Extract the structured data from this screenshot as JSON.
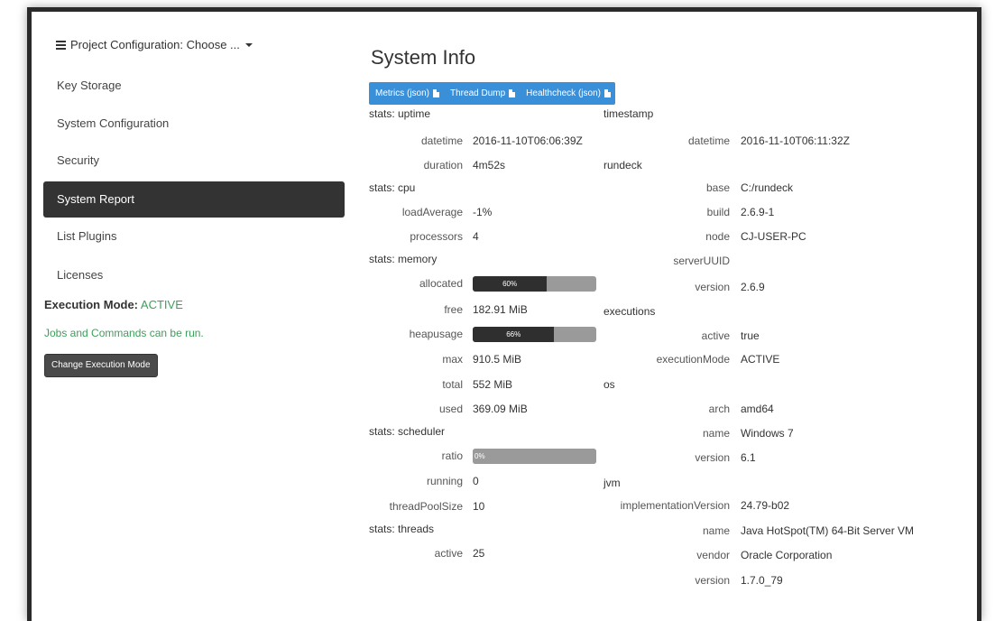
{
  "sidebar": {
    "project_menu": "Project Configuration: Choose ...",
    "items": [
      {
        "label": "Key Storage"
      },
      {
        "label": "System Configuration"
      },
      {
        "label": "Security"
      },
      {
        "label": "System Report",
        "active": true
      },
      {
        "label": "List Plugins"
      },
      {
        "label": "Licenses"
      }
    ],
    "execution_mode_label": "Execution Mode:",
    "execution_mode_value": "ACTIVE",
    "execution_note": "Jobs and Commands can be run.",
    "change_mode_button": "Change Execution Mode"
  },
  "main": {
    "title": "System Info",
    "toolbar": {
      "metrics": "Metrics (json)",
      "thread_dump": "Thread Dump",
      "healthcheck": "Healthcheck (json)"
    },
    "left": {
      "uptime_header": "stats: uptime",
      "datetime_key": "datetime",
      "datetime_val": "2016-11-10T06:06:39Z",
      "duration_key": "duration",
      "duration_val": "4m52s",
      "cpu_header": "stats: cpu",
      "loadavg_key": "loadAverage",
      "loadavg_val": "-1%",
      "processors_key": "processors",
      "processors_val": "4",
      "memory_header": "stats: memory",
      "allocated_key": "allocated",
      "allocated_pct": "60%",
      "free_key": "free",
      "free_val": "182.91 MiB",
      "heapusage_key": "heapusage",
      "heapusage_pct": "66%",
      "max_key": "max",
      "max_val": "910.5 MiB",
      "total_key": "total",
      "total_val": "552 MiB",
      "used_key": "used",
      "used_val": "369.09 MiB",
      "scheduler_header": "stats: scheduler",
      "ratio_key": "ratio",
      "ratio_pct": "0%",
      "running_key": "running",
      "running_val": "0",
      "threadpool_key": "threadPoolSize",
      "threadpool_val": "10",
      "threads_header": "stats: threads",
      "active_key": "active",
      "active_val": "25"
    },
    "right": {
      "timestamp_header": "timestamp",
      "ts_datetime_key": "datetime",
      "ts_datetime_val": "2016-11-10T06:11:32Z",
      "rundeck_header": "rundeck",
      "base_key": "base",
      "base_val": "C:/rundeck",
      "build_key": "build",
      "build_val": "2.6.9-1",
      "node_key": "node",
      "node_val": "CJ-USER-PC",
      "uuid_key": "serverUUID",
      "uuid_val": "",
      "rd_version_key": "version",
      "rd_version_val": "2.6.9",
      "executions_header": "executions",
      "ex_active_key": "active",
      "ex_active_val": "true",
      "ex_mode_key": "executionMode",
      "ex_mode_val": "ACTIVE",
      "os_header": "os",
      "arch_key": "arch",
      "arch_val": "amd64",
      "os_name_key": "name",
      "os_name_val": "Windows 7",
      "os_version_key": "version",
      "os_version_val": "6.1",
      "jvm_header": "jvm",
      "impl_key": "implementationVersion",
      "impl_val": "24.79-b02",
      "jvm_name_key": "name",
      "jvm_name_val": "Java HotSpot(TM) 64-Bit Server VM",
      "vendor_key": "vendor",
      "vendor_val": "Oracle Corporation",
      "jvm_version_key": "version",
      "jvm_version_val": "1.7.0_79"
    },
    "progress": {
      "allocated": 0.6,
      "heapusage": 0.66,
      "ratio": 0.0
    }
  },
  "colors": {
    "accent": "#3a8fd9",
    "active_nav": "#333333",
    "status_green": "#3d9f5a"
  }
}
